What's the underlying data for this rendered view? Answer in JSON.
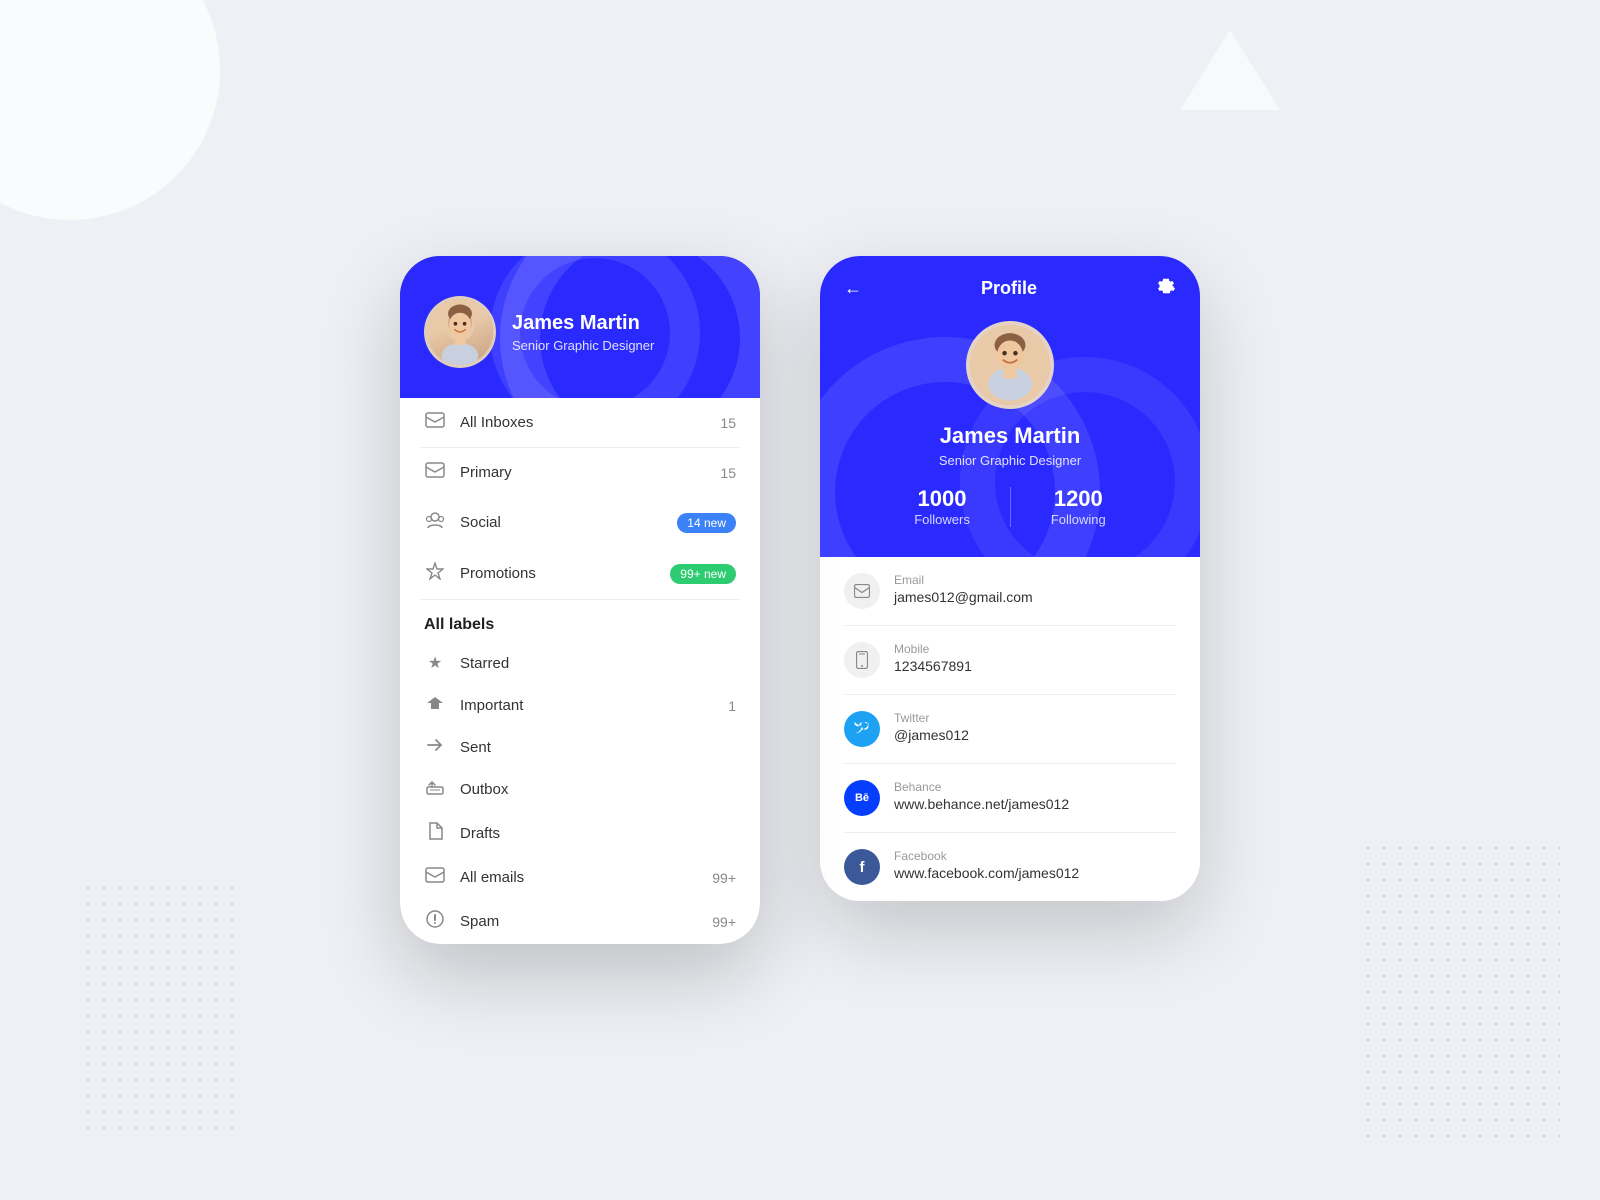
{
  "background": {
    "color": "#eef0f5"
  },
  "phone1": {
    "header": {
      "name": "James Martin",
      "title": "Senior Graphic Designer"
    },
    "inboxes": {
      "all_inboxes_label": "All Inboxes",
      "all_inboxes_count": "15"
    },
    "categories": [
      {
        "icon": "✉",
        "label": "Primary",
        "count": "15",
        "badge": null
      },
      {
        "icon": "👥",
        "label": "Social",
        "count": null,
        "badge": "14 new",
        "badge_type": "blue"
      },
      {
        "icon": "🏷",
        "label": "Promotions",
        "count": null,
        "badge": "99+ new",
        "badge_type": "green"
      }
    ],
    "all_labels_heading": "All labels",
    "labels": [
      {
        "icon": "★",
        "label": "Starred",
        "count": ""
      },
      {
        "icon": "▶",
        "label": "Important",
        "count": "1"
      },
      {
        "icon": "➤",
        "label": "Sent",
        "count": ""
      },
      {
        "icon": "⬆",
        "label": "Outbox",
        "count": ""
      },
      {
        "icon": "📄",
        "label": "Drafts",
        "count": ""
      },
      {
        "icon": "✉",
        "label": "All emails",
        "count": "99+"
      },
      {
        "icon": "⚠",
        "label": "Spam",
        "count": "99+"
      }
    ]
  },
  "phone2": {
    "nav": {
      "title": "Profile",
      "back_label": "←",
      "settings_label": "⚙"
    },
    "profile": {
      "name": "James Martin",
      "title": "Senior Graphic Designer",
      "followers_count": "1000",
      "followers_label": "Followers",
      "following_count": "1200",
      "following_label": "Following"
    },
    "contact": [
      {
        "type": "email",
        "label": "Email",
        "value": "james012@gmail.com",
        "icon": "✉",
        "icon_class": ""
      },
      {
        "type": "mobile",
        "label": "Mobile",
        "value": "1234567891",
        "icon": "📱",
        "icon_class": ""
      },
      {
        "type": "twitter",
        "label": "Twitter",
        "value": "@james012",
        "icon": "🐦",
        "icon_class": "icon-twitter"
      },
      {
        "type": "behance",
        "label": "Behance",
        "value": "www.behance.net/james012",
        "icon": "Bē",
        "icon_class": "icon-behance"
      },
      {
        "type": "facebook",
        "label": "Facebook",
        "value": "www.facebook.com/james012",
        "icon": "f",
        "icon_class": "icon-facebook"
      }
    ]
  }
}
